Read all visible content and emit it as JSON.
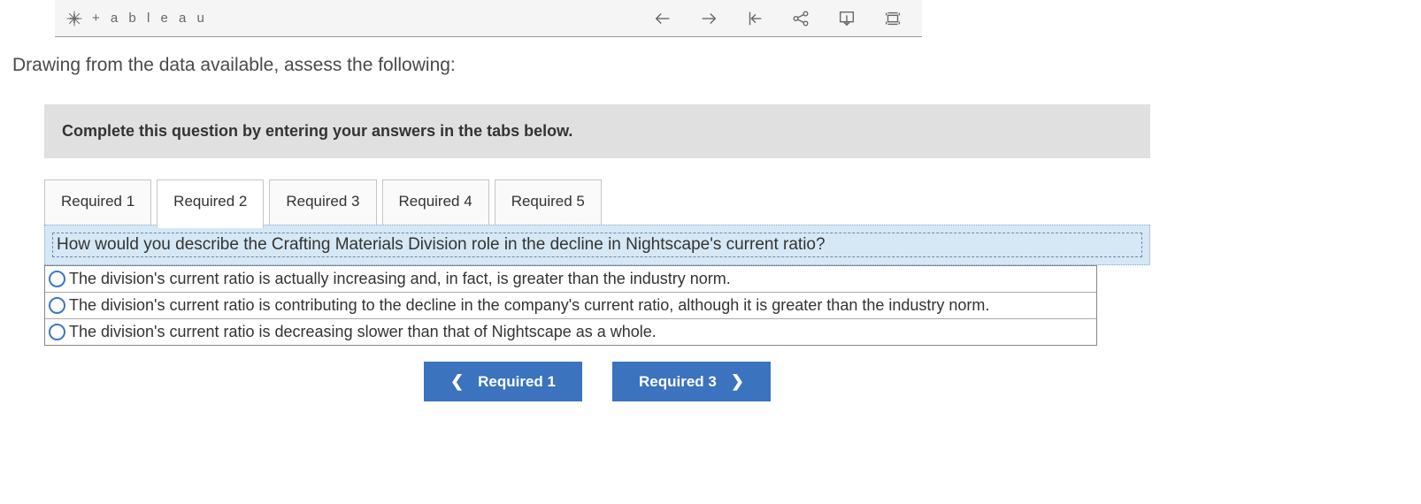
{
  "toolbar": {
    "brand": "+ a b l e a u"
  },
  "prompt": "Drawing from the data available, assess the following:",
  "instruction": "Complete this question by entering your answers in the tabs below.",
  "tabs": [
    {
      "label": "Required 1"
    },
    {
      "label": "Required 2"
    },
    {
      "label": "Required 3"
    },
    {
      "label": "Required 4"
    },
    {
      "label": "Required 5"
    }
  ],
  "active_tab_index": 1,
  "question": "How would you describe the Crafting Materials Division role in the decline in Nightscape's current ratio?",
  "options": [
    "The division's current ratio is actually increasing and, in fact, is greater than the industry norm.",
    "The division's current ratio is contributing to the decline in the company's current ratio, although it is greater than the industry norm.",
    "The division's current ratio is decreasing slower than that of Nightscape as a whole."
  ],
  "nav": {
    "prev_label": "Required 1",
    "next_label": "Required 3"
  }
}
